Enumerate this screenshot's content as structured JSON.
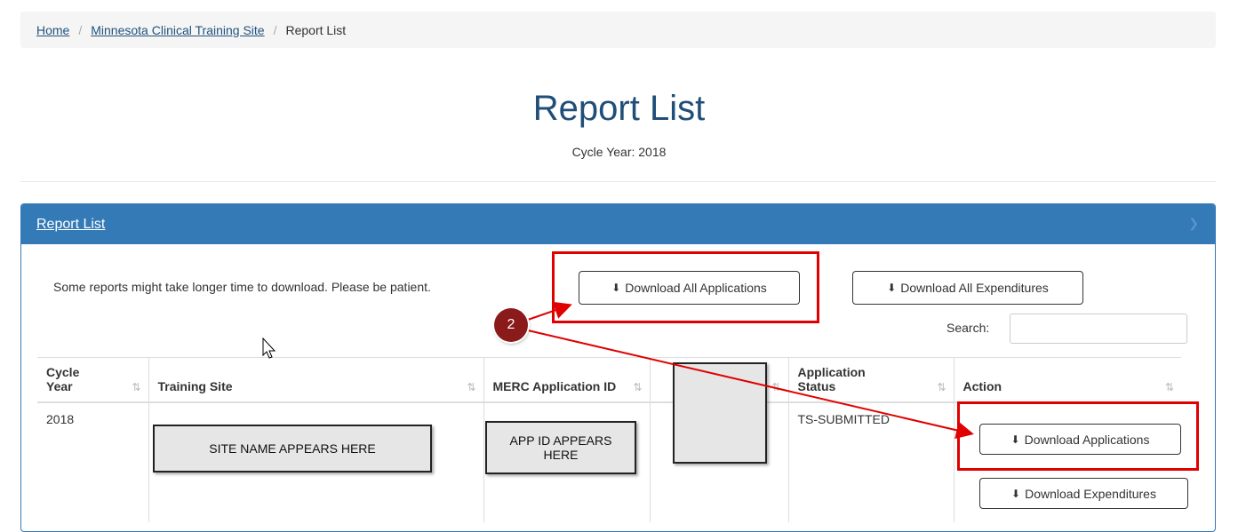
{
  "breadcrumb": {
    "home": "Home",
    "site": "Minnesota Clinical Training Site",
    "current": "Report List",
    "separator": "/"
  },
  "header": {
    "title": "Report List",
    "subtitle": "Cycle Year: 2018"
  },
  "panel": {
    "heading": "Report List",
    "note": "Some reports might take longer time to download. Please be patient.",
    "download_all_applications": "Download All Applications",
    "download_all_expenditures": "Download All Expenditures",
    "search_label": "Search:",
    "search_value": ""
  },
  "table": {
    "columns": [
      "Cycle Year",
      "Training Site",
      "MERC Application ID",
      "",
      "Application Status",
      "Action"
    ],
    "rows": [
      {
        "cycle_year": "2018",
        "status": "TS-SUBMITTED",
        "download_applications": "Download Applications",
        "download_expenditures": "Download Expenditures"
      }
    ]
  },
  "annotations": {
    "site_placeholder": "SITE NAME APPEARS HERE",
    "app_id_placeholder": "APP ID APPEARS HERE",
    "step_number": "2",
    "highlight_color": "#e00000"
  },
  "colors": {
    "panel_blue": "#337ab7",
    "title_blue": "#1f4e79",
    "badge": "#8b1a1a"
  }
}
